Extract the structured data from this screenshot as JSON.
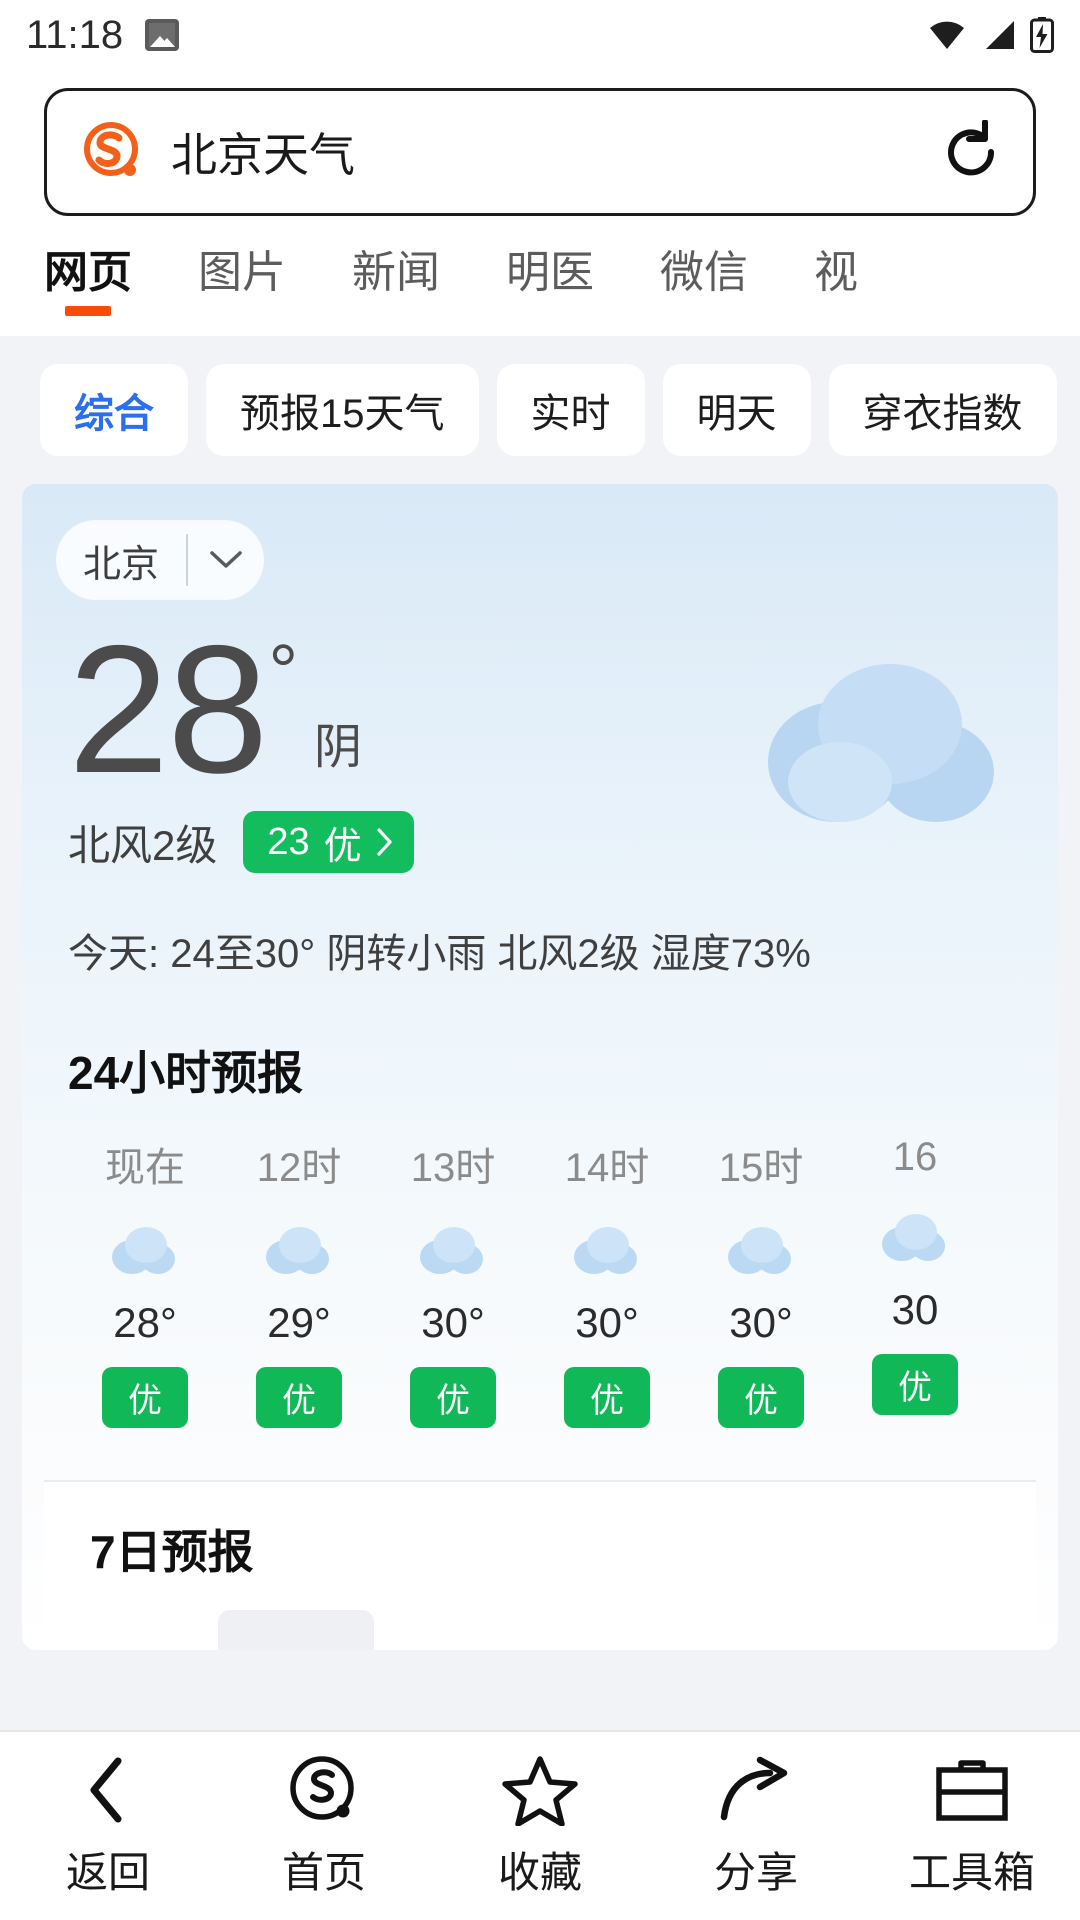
{
  "statusbar": {
    "time": "11:18",
    "icons": [
      "image-icon",
      "wifi-icon",
      "signal-icon",
      "battery-charging-icon"
    ]
  },
  "search": {
    "logo": "sogou-logo",
    "query": "北京天气",
    "refresh_label": "refresh-icon"
  },
  "tabs": [
    {
      "label": "网页",
      "active": true
    },
    {
      "label": "图片",
      "active": false
    },
    {
      "label": "新闻",
      "active": false
    },
    {
      "label": "明医",
      "active": false
    },
    {
      "label": "微信",
      "active": false
    },
    {
      "label": "视",
      "active": false
    }
  ],
  "chips": [
    {
      "label": "综合",
      "active": true
    },
    {
      "label": "预报15天气",
      "active": false
    },
    {
      "label": "实时",
      "active": false
    },
    {
      "label": "明天",
      "active": false
    },
    {
      "label": "穿衣指数",
      "active": false
    }
  ],
  "weather": {
    "city": "北京",
    "temperature": "28",
    "degree_symbol": "°",
    "condition": "阴",
    "wind": "北风2级",
    "aqi_value": "23",
    "aqi_level": "优",
    "today_summary": "今天: 24至30°  阴转小雨  北风2级  湿度73%",
    "accent_green": "#13bd5e",
    "accent_blue": "#2b6ef0",
    "accent_orange": "#fa4b09"
  },
  "hourly": {
    "title": "24小时预报",
    "items": [
      {
        "time": "现在",
        "icon": "cloud-icon",
        "temp": "28°",
        "aqi": "优"
      },
      {
        "time": "12时",
        "icon": "cloud-icon",
        "temp": "29°",
        "aqi": "优"
      },
      {
        "time": "13时",
        "icon": "cloud-icon",
        "temp": "30°",
        "aqi": "优"
      },
      {
        "time": "14时",
        "icon": "cloud-icon",
        "temp": "30°",
        "aqi": "优"
      },
      {
        "time": "15时",
        "icon": "cloud-icon",
        "temp": "30°",
        "aqi": "优"
      },
      {
        "time": "16",
        "icon": "cloud-icon",
        "temp": "30",
        "aqi": "优"
      }
    ]
  },
  "daily": {
    "title": "7日预报"
  },
  "bottomnav": [
    {
      "label": "返回",
      "icon": "back-chevron-icon"
    },
    {
      "label": "首页",
      "icon": "sogou-home-icon"
    },
    {
      "label": "收藏",
      "icon": "star-icon"
    },
    {
      "label": "分享",
      "icon": "share-arrow-icon"
    },
    {
      "label": "工具箱",
      "icon": "toolbox-icon"
    }
  ]
}
